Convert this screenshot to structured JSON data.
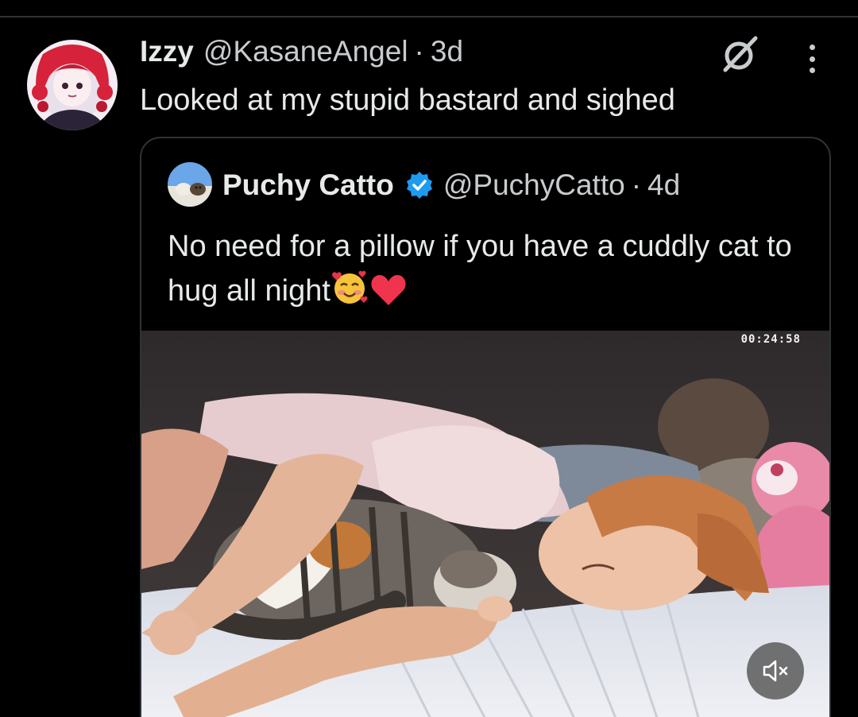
{
  "tweet": {
    "author_name": "Izzy",
    "author_handle": "@KasaneAngel",
    "separator": "·",
    "time": "3d",
    "text": "Looked at my stupid bastard and sighed",
    "avatar_icon": "anime-avatar-red-hair"
  },
  "actions": {
    "grok_icon": "grok-icon",
    "more_icon": "more-options-icon"
  },
  "quote": {
    "author_name": "Puchy Catto",
    "verified_icon": "verified-badge-icon",
    "author_handle": "@PuchyCatto",
    "separator": "·",
    "time": "4d",
    "text": "No need for a pillow if you have a cuddly cat to hug all night",
    "emojis": [
      "smiling-face-with-hearts",
      "red-heart"
    ]
  },
  "video": {
    "timestamp": "00:24:58",
    "mute_icon": "speaker-muted-icon"
  },
  "colors": {
    "background": "#000000",
    "text_primary": "#e7e9ea",
    "text_secondary": "#c9ccce",
    "border": "#2f3336",
    "verified_blue": "#1d9bf0"
  }
}
